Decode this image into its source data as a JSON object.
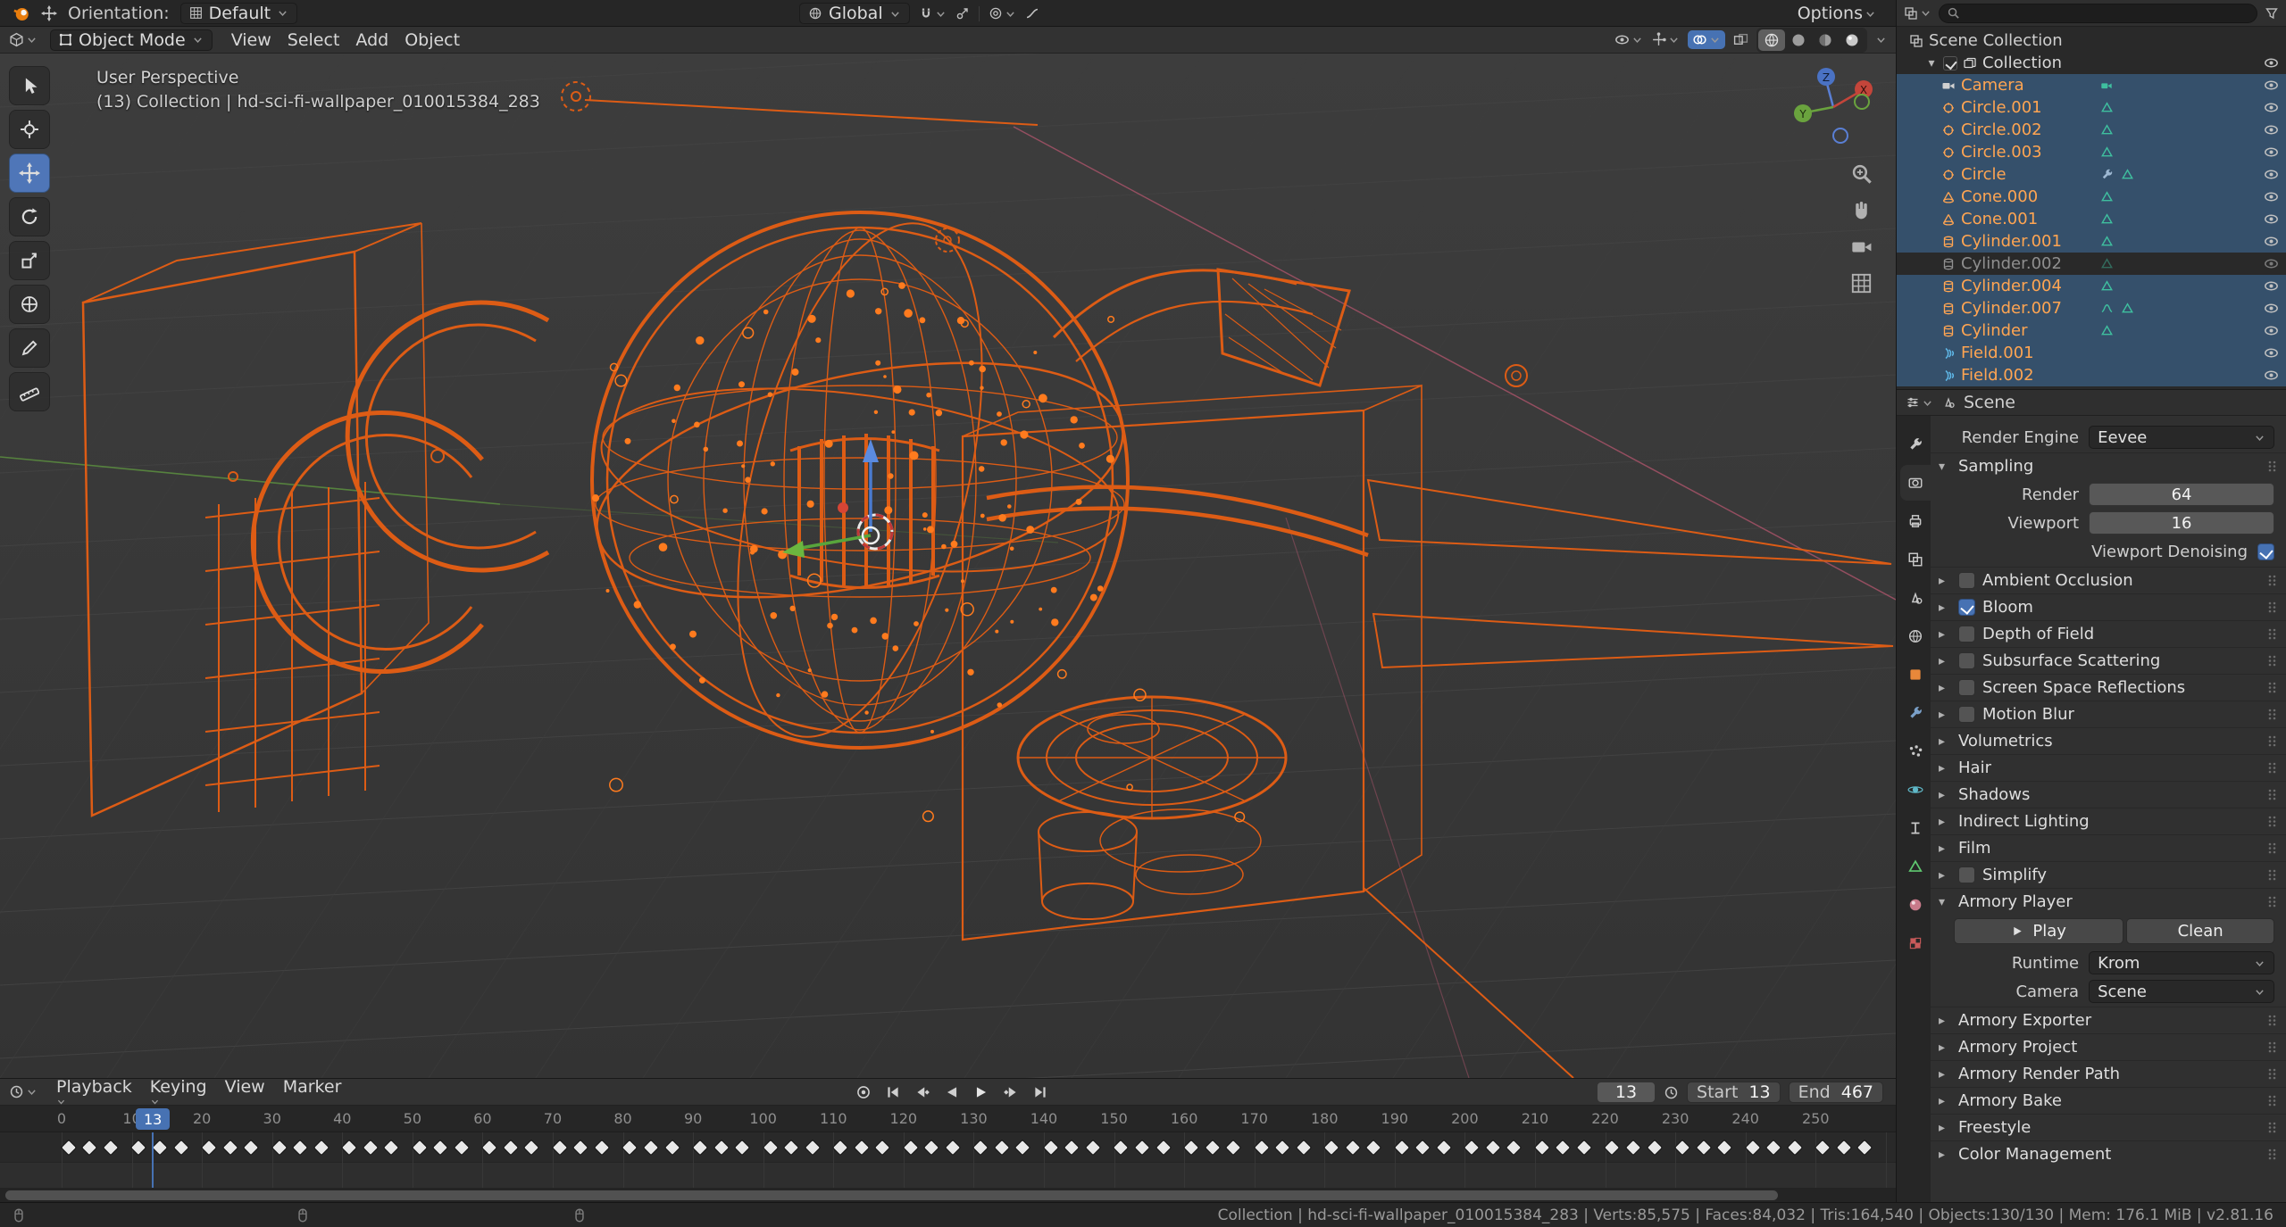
{
  "topbar": {
    "orientation_label": "Orientation:",
    "orientation_value": "Default",
    "transform_space": "Global",
    "options_label": "Options"
  },
  "viewport_header": {
    "mode": "Object Mode",
    "menus": [
      "View",
      "Select",
      "Add",
      "Object"
    ]
  },
  "viewport": {
    "perspective_label": "User Perspective",
    "breadcrumb": "(13) Collection | hd-sci-fi-wallpaper_010015384_283",
    "gizmo_axes": [
      "X",
      "Y",
      "Z"
    ],
    "colors": {
      "wire_orange": "#dd5c15",
      "axis_x": "#c4453a",
      "axis_y": "#6aa33e",
      "axis_z": "#4a72c4",
      "accent": "#4772b3"
    }
  },
  "outliner": {
    "root_label": "Scene Collection",
    "items": [
      {
        "label": "Collection",
        "icon": "collection",
        "indent": 1,
        "selected": false,
        "checkbox": true,
        "arrow": true,
        "plain": true,
        "extras": []
      },
      {
        "label": "Camera",
        "icon": "camera",
        "indent": 2,
        "selected": true,
        "extras": [
          "camera-data"
        ]
      },
      {
        "label": "Circle.001",
        "icon": "mesh-circle",
        "indent": 2,
        "selected": true,
        "extras": [
          "mesh-data"
        ]
      },
      {
        "label": "Circle.002",
        "icon": "mesh-circle",
        "indent": 2,
        "selected": true,
        "extras": [
          "mesh-data"
        ]
      },
      {
        "label": "Circle.003",
        "icon": "mesh-circle",
        "indent": 2,
        "selected": true,
        "extras": [
          "mesh-data"
        ]
      },
      {
        "label": "Circle",
        "icon": "mesh-circle",
        "indent": 2,
        "selected": true,
        "extras": [
          "modifier",
          "mesh-data"
        ]
      },
      {
        "label": "Cone.000",
        "icon": "mesh-cone",
        "indent": 2,
        "selected": true,
        "extras": [
          "mesh-data"
        ]
      },
      {
        "label": "Cone.001",
        "icon": "mesh-cone",
        "indent": 2,
        "selected": true,
        "extras": [
          "mesh-data"
        ]
      },
      {
        "label": "Cylinder.001",
        "icon": "mesh-cylinder",
        "indent": 2,
        "selected": true,
        "extras": [
          "mesh-data"
        ]
      },
      {
        "label": "Cylinder.002",
        "icon": "mesh-cylinder",
        "indent": 2,
        "selected": false,
        "dim": true,
        "extras": [
          "mesh-data"
        ]
      },
      {
        "label": "Cylinder.004",
        "icon": "mesh-cylinder",
        "indent": 2,
        "selected": true,
        "extras": [
          "mesh-data"
        ]
      },
      {
        "label": "Cylinder.007",
        "icon": "mesh-cylinder",
        "indent": 2,
        "selected": true,
        "extras": [
          "driver",
          "mesh-data"
        ]
      },
      {
        "label": "Cylinder",
        "icon": "mesh-cylinder",
        "indent": 2,
        "selected": true,
        "extras": [
          "mesh-data"
        ]
      },
      {
        "label": "Field.001",
        "icon": "force-field",
        "indent": 2,
        "selected": true,
        "extras": []
      },
      {
        "label": "Field.002",
        "icon": "force-field",
        "indent": 2,
        "selected": true,
        "extras": []
      }
    ]
  },
  "properties": {
    "breadcrumb": "Scene",
    "render_engine_label": "Render Engine",
    "render_engine_value": "Eevee",
    "sampling": {
      "title": "Sampling",
      "render_label": "Render",
      "render_value": "64",
      "viewport_label": "Viewport",
      "viewport_value": "16",
      "denoising_label": "Viewport Denoising",
      "denoising_checked": true
    },
    "toggle_sections": [
      {
        "label": "Ambient Occlusion",
        "checkbox": false
      },
      {
        "label": "Bloom",
        "checkbox": true
      },
      {
        "label": "Depth of Field",
        "checkbox": false
      },
      {
        "label": "Subsurface Scattering",
        "checkbox": false
      },
      {
        "label": "Screen Space Reflections",
        "checkbox": false
      },
      {
        "label": "Motion Blur",
        "checkbox": false
      },
      {
        "label": "Volumetrics"
      },
      {
        "label": "Hair"
      },
      {
        "label": "Shadows"
      },
      {
        "label": "Indirect Lighting"
      },
      {
        "label": "Film"
      },
      {
        "label": "Simplify",
        "checkbox": false
      }
    ],
    "armory_player": {
      "title": "Armory Player",
      "play_label": "Play",
      "clean_label": "Clean",
      "runtime_label": "Runtime",
      "runtime_value": "Krom",
      "camera_label": "Camera",
      "camera_value": "Scene"
    },
    "bottom_sections": [
      {
        "label": "Armory Exporter"
      },
      {
        "label": "Armory Project"
      },
      {
        "label": "Armory Render Path"
      },
      {
        "label": "Armory Bake"
      },
      {
        "label": "Freestyle"
      },
      {
        "label": "Color Management"
      }
    ]
  },
  "timeline": {
    "menus": [
      "Playback",
      "Keying",
      "View",
      "Marker"
    ],
    "current_frame": "13",
    "start_label": "Start",
    "start_value": "13",
    "end_label": "End",
    "end_value": "467",
    "tick_step": 10,
    "tick_max": 250,
    "keyframes": [
      1,
      4,
      7,
      11,
      14,
      17,
      21,
      24,
      27,
      31,
      34,
      37,
      41,
      44,
      47,
      51,
      54,
      57,
      61,
      64,
      67,
      71,
      74,
      77,
      81,
      84,
      87,
      91,
      94,
      97,
      101,
      104,
      107,
      111,
      114,
      117,
      121,
      124,
      127,
      131,
      134,
      137,
      141,
      144,
      147,
      151,
      154,
      157,
      161,
      164,
      167,
      171,
      174,
      177,
      181,
      184,
      187,
      191,
      194,
      197,
      201,
      204,
      207,
      211,
      214,
      217,
      221,
      224,
      227,
      231,
      234,
      237,
      241,
      244,
      247,
      251,
      254,
      257
    ]
  },
  "statusbar": {
    "text": "Collection | hd-sci-fi-wallpaper_010015384_283 | Verts:85,575 | Faces:84,032 | Tris:164,540 | Objects:130/130 | Mem: 176.1 MiB | v2.81.16"
  }
}
